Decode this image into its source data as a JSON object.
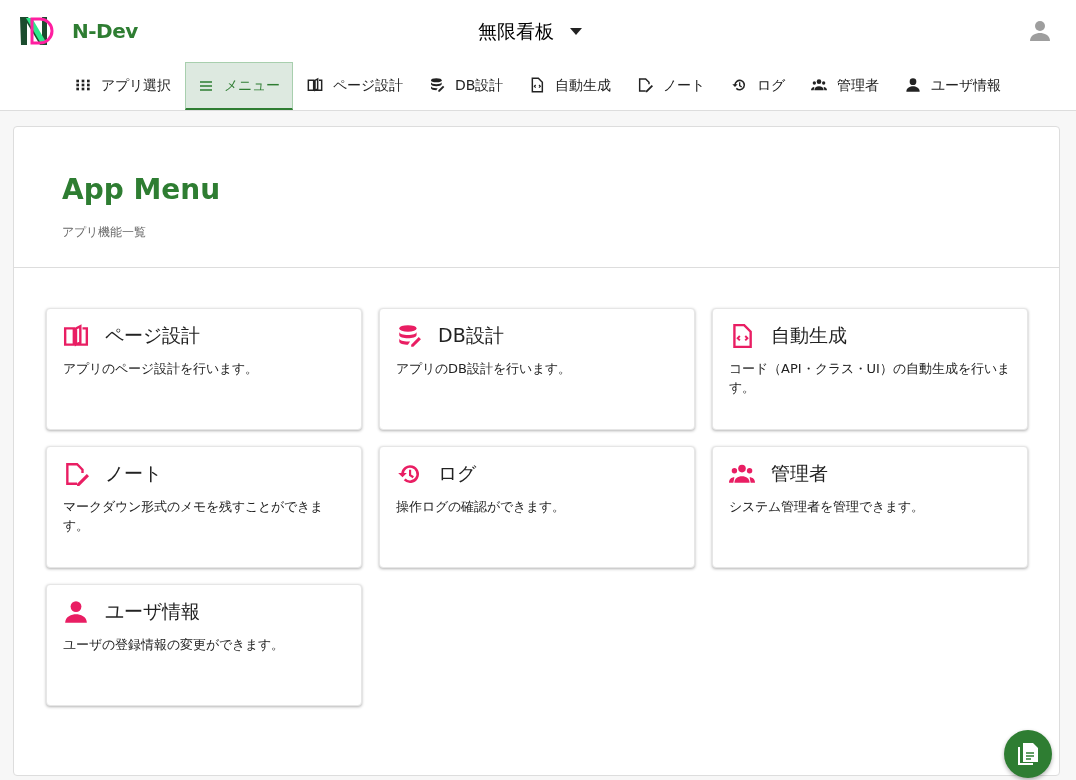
{
  "app": {
    "name": "N-Dev"
  },
  "board": {
    "title": "無限看板"
  },
  "tabs": [
    {
      "label": "アプリ選択",
      "selected": false
    },
    {
      "label": "メニュー",
      "selected": true
    },
    {
      "label": "ページ設計",
      "selected": false
    },
    {
      "label": "DB設計",
      "selected": false
    },
    {
      "label": "自動生成",
      "selected": false
    },
    {
      "label": "ノート",
      "selected": false
    },
    {
      "label": "ログ",
      "selected": false
    },
    {
      "label": "管理者",
      "selected": false
    },
    {
      "label": "ユーザ情報",
      "selected": false
    }
  ],
  "page": {
    "title": "App Menu",
    "subtitle": "アプリ機能一覧"
  },
  "cards": [
    {
      "title": "ページ設計",
      "description": "アプリのページ設計を行います。"
    },
    {
      "title": "DB設計",
      "description": "アプリのDB設計を行います。"
    },
    {
      "title": "自動生成",
      "description": "コード（API・クラス・UI）の自動生成を行います。"
    },
    {
      "title": "ノート",
      "description": "マークダウン形式のメモを残すことができます。"
    },
    {
      "title": "ログ",
      "description": "操作ログの確認ができます。"
    },
    {
      "title": "管理者",
      "description": "システム管理者を管理できます。"
    },
    {
      "title": "ユーザ情報",
      "description": "ユーザの登録情報の変更ができます。"
    }
  ]
}
